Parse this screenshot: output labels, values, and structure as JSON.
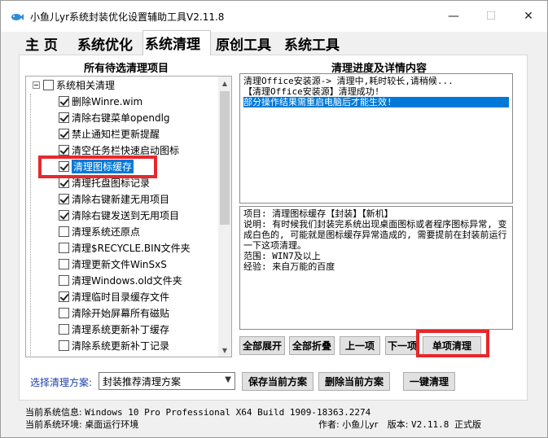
{
  "window": {
    "title": "小鱼儿yr系统封装优化设置辅助工具V2.11.8",
    "minimize_glyph": "—",
    "maximize_glyph": "☐",
    "close_glyph": "✕"
  },
  "tabs": [
    {
      "label": "主 页"
    },
    {
      "label": "系统优化"
    },
    {
      "label": "系统清理"
    },
    {
      "label": "原创工具"
    },
    {
      "label": "系统工具"
    }
  ],
  "left_panel": {
    "title": "所有待选清理项目",
    "root": {
      "label": "系统相关清理",
      "checked": false
    },
    "items": [
      {
        "label": "删除Winre.wim",
        "checked": true
      },
      {
        "label": "清除右键菜单opendlg",
        "checked": true
      },
      {
        "label": "禁止通知栏更新提醒",
        "checked": true
      },
      {
        "label": "清空任务栏快速启动图标",
        "checked": true
      },
      {
        "label": "清理图标缓存",
        "checked": true
      },
      {
        "label": "清理托盘图标记录",
        "checked": true
      },
      {
        "label": "清除右键新建无用项目",
        "checked": true
      },
      {
        "label": "清除右键发送到无用项目",
        "checked": true
      },
      {
        "label": "清理系统还原点",
        "checked": false
      },
      {
        "label": "清理$RECYCLE.BIN文件夹",
        "checked": false
      },
      {
        "label": "清理更新文件WinSxS",
        "checked": false
      },
      {
        "label": "清理Windows.old文件夹",
        "checked": false
      },
      {
        "label": "清理临时目录缓存文件",
        "checked": true
      },
      {
        "label": "清除开始屏幕所有磁贴",
        "checked": false
      },
      {
        "label": "清理系统更新补丁缓存",
        "checked": false
      },
      {
        "label": "清除系统更新补丁记录",
        "checked": false
      }
    ]
  },
  "right_panel": {
    "title": "清理进度及详情内容",
    "log_lines": [
      "清理Office安装源-> 清理中,耗时较长,请稍候...",
      "【清理Office安装源】清理成功!",
      "部分操作结果需重启电脑后才能生效!"
    ],
    "detail_text": "项目: 清理图标缓存【封装】【新机】\n说明: 有时候我们封装完系统出现桌面图标或者程序图标异常, 变成白色的, 可能就是图标缓存异常造成的, 需要提前在封装前运行一下这项清理。\n范围: WIN7及以上\n经验: 来自万能的百度"
  },
  "buttons": {
    "expand_all": "全部展开",
    "collapse_all": "全部折叠",
    "prev": "上一项",
    "next": "下一项",
    "single_clean": "单项清理",
    "save_plan": "保存当前方案",
    "delete_plan": "删除当前方案",
    "one_click_clean": "一键清理"
  },
  "plan": {
    "label": "选择清理方案:",
    "selected": "封装推荐清理方案"
  },
  "status": {
    "system_label": "当前系统信息:",
    "system_value": "Windows 10 Pro Professional X64 Build 1909-18363.2274",
    "env_label": "当前系统环境:",
    "env_value": "桌面运行环境",
    "author_label": "作者:",
    "author_value": "小鱼儿yr",
    "version_label": "版本:",
    "version_value": "V2.11.8 正式版"
  },
  "colors": {
    "selection": "#0078d7",
    "highlight_red": "#e6282c",
    "plan_label": "#1c3faa"
  }
}
